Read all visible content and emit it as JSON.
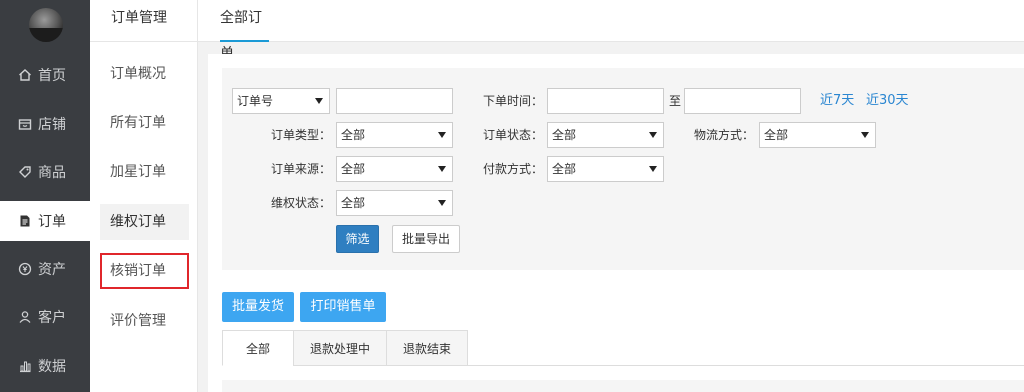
{
  "sidebar": {
    "items": [
      {
        "label": "首页",
        "icon": "home-icon"
      },
      {
        "label": "店铺",
        "icon": "shop-icon"
      },
      {
        "label": "商品",
        "icon": "tag-icon"
      },
      {
        "label": "订单",
        "icon": "document-icon"
      },
      {
        "label": "资产",
        "icon": "yen-coin-icon"
      },
      {
        "label": "客户",
        "icon": "user-icon"
      },
      {
        "label": "数据",
        "icon": "bar-chart-icon"
      }
    ]
  },
  "submenu": {
    "title": "订单管理",
    "items": [
      "订单概况",
      "所有订单",
      "加星订单",
      "维权订单",
      "核销订单",
      "评价管理"
    ]
  },
  "topbar": {
    "tab": "全部订单"
  },
  "filters": {
    "order_no_select": "订单号",
    "order_time_label": "下单时间：",
    "to_label": "至",
    "last7": "近7天",
    "last30": "近30天",
    "order_type_label": "订单类型：",
    "order_type_value": "全部",
    "order_status_label": "订单状态：",
    "order_status_value": "全部",
    "logistics_label": "物流方式：",
    "logistics_value": "全部",
    "order_source_label": "订单来源：",
    "order_source_value": "全部",
    "payment_label": "付款方式：",
    "payment_value": "全部",
    "rights_label": "维权状态：",
    "rights_value": "全部",
    "filter_button": "筛选",
    "export_button": "批量导出"
  },
  "actions": {
    "batch_ship": "批量发货",
    "print_sales": "打印销售单"
  },
  "tabs": [
    "全部",
    "退款处理中",
    "退款结束"
  ],
  "colors": {
    "sidebar_bg": "#3a3d41",
    "accent_blue": "#3da6f1",
    "filter_button": "#2f7fc1",
    "link": "#2a86d1",
    "highlight_box": "#e0262b"
  }
}
